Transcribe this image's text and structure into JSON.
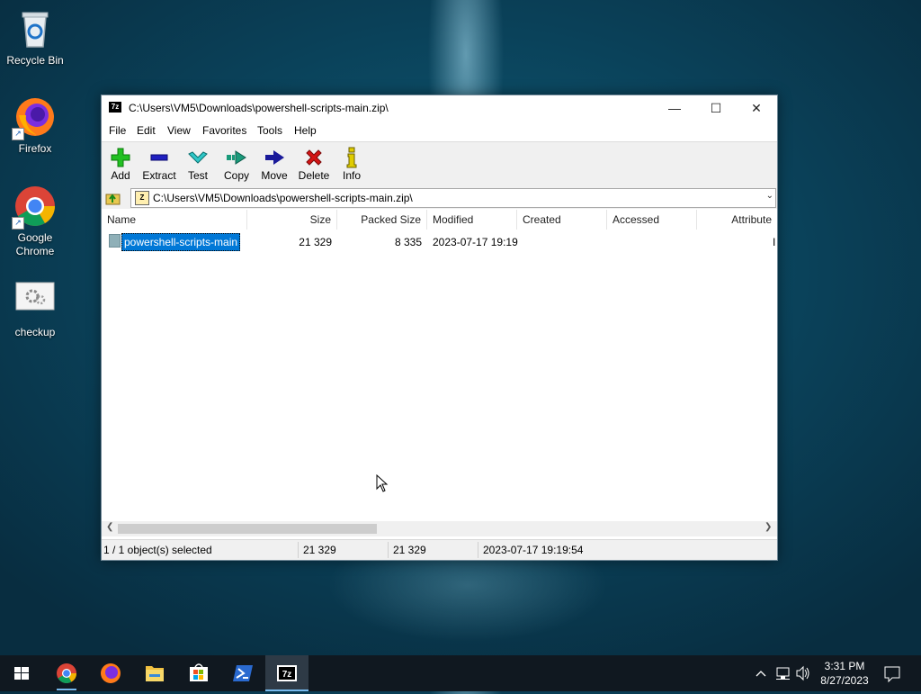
{
  "desktop": {
    "icons": [
      {
        "label": "Recycle Bin"
      },
      {
        "label": "Firefox"
      },
      {
        "label": "Google Chrome"
      },
      {
        "label": "checkup"
      }
    ]
  },
  "window": {
    "title": "C:\\Users\\VM5\\Downloads\\powershell-scripts-main.zip\\",
    "app_icon": "7z",
    "controls": {
      "minimize": "minimize-icon",
      "maximize": "maximize-icon",
      "close": "close-icon"
    }
  },
  "menu": [
    "File",
    "Edit",
    "View",
    "Favorites",
    "Tools",
    "Help"
  ],
  "toolbar": [
    {
      "label": "Add",
      "icon": "plus-icon",
      "color": "#1fbf1f"
    },
    {
      "label": "Extract",
      "icon": "minus-icon",
      "color": "#1f1fbf"
    },
    {
      "label": "Test",
      "icon": "check-icon",
      "color": "#22b8b8"
    },
    {
      "label": "Copy",
      "icon": "copy-arrow-icon",
      "color": "#1a8a6a"
    },
    {
      "label": "Move",
      "icon": "move-arrow-icon",
      "color": "#1a1a9a"
    },
    {
      "label": "Delete",
      "icon": "delete-x-icon",
      "color": "#d01010"
    },
    {
      "label": "Info",
      "icon": "info-icon",
      "color": "#c8b400"
    }
  ],
  "address": {
    "path": "C:\\Users\\VM5\\Downloads\\powershell-scripts-main.zip\\"
  },
  "columns": [
    "Name",
    "Size",
    "Packed Size",
    "Modified",
    "Created",
    "Accessed",
    "Attribute"
  ],
  "rows": [
    {
      "name": "powershell-scripts-main",
      "size": "21 329",
      "packed": "8 335",
      "modified": "2023-07-17 19:19",
      "created": "",
      "accessed": "",
      "attribute": "I"
    }
  ],
  "status": {
    "selection": "1 / 1 object(s) selected",
    "size": "21 329",
    "packed": "21 329",
    "modified": "2023-07-17 19:19:54"
  },
  "taskbar": {
    "apps": [
      "Start",
      "Google Chrome",
      "Firefox",
      "File Explorer",
      "Microsoft Store",
      "PowerShell",
      "7-Zip"
    ],
    "time": "3:31 PM",
    "date": "8/27/2023"
  },
  "colors": {
    "selection": "#0078d7",
    "taskbar": "#101820",
    "taskbar_active_underline": "#76b9ed"
  }
}
